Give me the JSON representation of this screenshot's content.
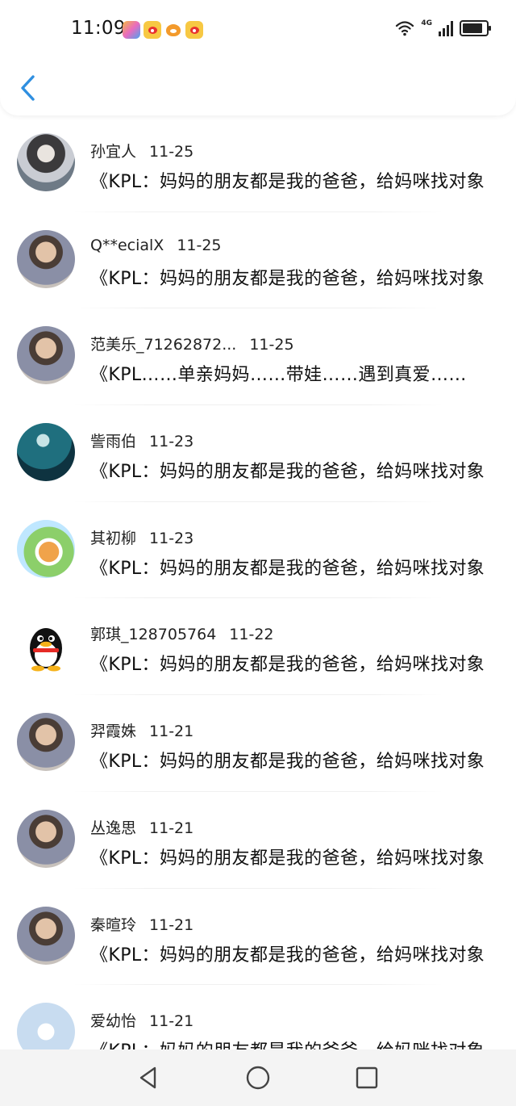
{
  "status_bar": {
    "time": "11:09",
    "notification_icons": [
      "app-icon",
      "weibo-icon",
      "fox-icon",
      "weibo-icon"
    ],
    "network_label": "4G",
    "battery_level": 0.85
  },
  "header": {
    "back_icon": "chevron-left-icon",
    "accent_color": "#2f8fe0"
  },
  "messages": [
    {
      "name": "孙宜人",
      "date": "11-25",
      "text": "《KPL：妈妈的朋友都是我的爸爸，给妈咪找对象",
      "avatar": "anime-character"
    },
    {
      "name": "Q**ecialX",
      "date": "11-25",
      "text": "《KPL：妈妈的朋友都是我的爸爸，给妈咪找对象",
      "avatar": "person-photo"
    },
    {
      "name": "范美乐_71262872...",
      "date": "11-25",
      "text": "《KPL……单亲妈妈……带娃……遇到真爱……",
      "avatar": "person-photo"
    },
    {
      "name": "訾雨伯",
      "date": "11-23",
      "text": "《KPL：妈妈的朋友都是我的爸爸，给妈咪找对象",
      "avatar": "teal-scene"
    },
    {
      "name": "其初柳",
      "date": "11-23",
      "text": "《KPL：妈妈的朋友都是我的爸爸，给妈咪找对象",
      "avatar": "cartoon-dog"
    },
    {
      "name": "郭琪_128705764",
      "date": "11-22",
      "text": "《KPL：妈妈的朋友都是我的爸爸，给妈咪找对象",
      "avatar": "qq-penguin"
    },
    {
      "name": "羿霞姝",
      "date": "11-21",
      "text": "《KPL：妈妈的朋友都是我的爸爸，给妈咪找对象",
      "avatar": "person-photo"
    },
    {
      "name": "丛逸思",
      "date": "11-21",
      "text": "《KPL：妈妈的朋友都是我的爸爸，给妈咪找对象",
      "avatar": "person-photo"
    },
    {
      "name": "秦暄玲",
      "date": "11-21",
      "text": "《KPL：妈妈的朋友都是我的爸爸，给妈咪找对象",
      "avatar": "person-photo"
    },
    {
      "name": "爱幼怡",
      "date": "11-21",
      "text": "《KPL：妈妈的朋友都是我的爸爸，给妈咪找对象",
      "avatar": "default-star"
    }
  ],
  "nav_bar": {
    "back": "triangle-back-icon",
    "home": "circle-home-icon",
    "recent": "square-recent-icon"
  }
}
